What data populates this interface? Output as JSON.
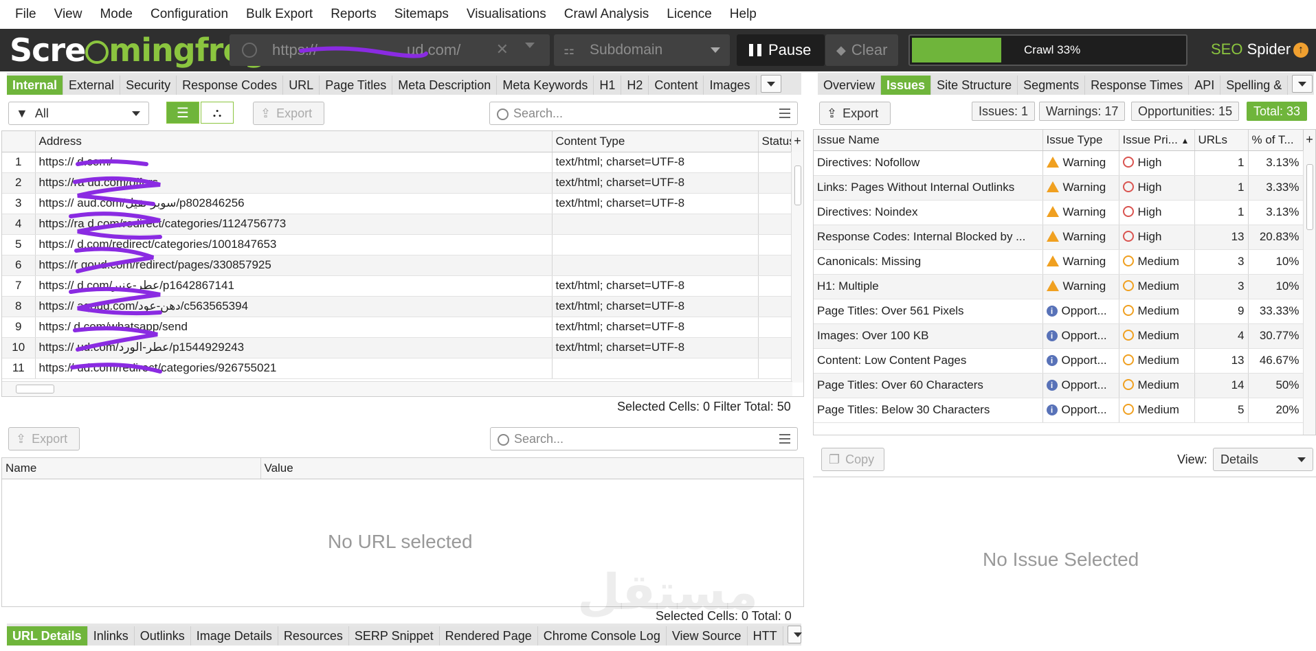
{
  "menu": [
    "File",
    "View",
    "Mode",
    "Configuration",
    "Bulk Export",
    "Reports",
    "Sitemaps",
    "Visualisations",
    "Crawl Analysis",
    "Licence",
    "Help"
  ],
  "topbar": {
    "logo_a": "Scre",
    "logo_b": "mingfrog",
    "url": "https://",
    "url_suffix": "ud.com/",
    "subdomain": "Subdomain",
    "pause": "Pause",
    "clear": "Clear",
    "crawl": "Crawl 33%",
    "crawl_progress": 0.33,
    "seo": "SEO",
    "spider": "Spider",
    "brand_color": "#8bc53f"
  },
  "left_tabs": [
    "Internal",
    "External",
    "Security",
    "Response Codes",
    "URL",
    "Page Titles",
    "Meta Description",
    "Meta Keywords",
    "H1",
    "H2",
    "Content",
    "Images"
  ],
  "filter": {
    "value": "All",
    "export": "Export",
    "search_placeholder": "Search..."
  },
  "main_table": {
    "headers": [
      "Address",
      "Content Type",
      "Status"
    ],
    "rows": [
      {
        "n": "1",
        "address": "https://                    d.com/",
        "type": "text/html; charset=UTF-8"
      },
      {
        "n": "2",
        "address": "https://ra              ud.com/offers",
        "type": "text/html; charset=UTF-8"
      },
      {
        "n": "3",
        "address": "https://                 aud.com/سوبر-نقيل/p802846256",
        "type": "text/html; charset=UTF-8"
      },
      {
        "n": "4",
        "address": "https://ra         d.com/redirect/categories/1124756773",
        "type": ""
      },
      {
        "n": "5",
        "address": "https://              d.com/redirect/categories/1001847653",
        "type": ""
      },
      {
        "n": "6",
        "address": "https://r       qoud.com/redirect/pages/330857925",
        "type": ""
      },
      {
        "n": "7",
        "address": "https://                 d.com/عطر-عنبر/p1642867141",
        "type": "text/html; charset=UTF-8"
      },
      {
        "n": "8",
        "address": "https://          aqoud.com/دهن-عود/c563565394",
        "type": "text/html; charset=UTF-8"
      },
      {
        "n": "9",
        "address": "https:/              d.com/whatsapp/send",
        "type": "text/html; charset=UTF-8"
      },
      {
        "n": "10",
        "address": "https://             ud.com/عطر-الورد/p1544929243",
        "type": "text/html; charset=UTF-8"
      },
      {
        "n": "11",
        "address": "https://             ud.com/redirect/categories/926755021",
        "type": ""
      }
    ],
    "status_bar": "Selected Cells:  0  Filter Total:  50"
  },
  "detail": {
    "export": "Export",
    "search_placeholder": "Search...",
    "headers": [
      "Name",
      "Value"
    ],
    "empty": "No URL selected",
    "status_bar": "Selected Cells:  0  Total:  0"
  },
  "bottom_tabs": [
    "URL Details",
    "Inlinks",
    "Outlinks",
    "Image Details",
    "Resources",
    "SERP Snippet",
    "Rendered Page",
    "Chrome Console Log",
    "View Source",
    "HTT"
  ],
  "right_tabs": [
    "Overview",
    "Issues",
    "Site Structure",
    "Segments",
    "Response Times",
    "API",
    "Spelling &"
  ],
  "issues_toolbar": {
    "export": "Export",
    "issues": "Issues: 1",
    "warnings": "Warnings: 17",
    "opportunities": "Opportunities: 15",
    "total": "Total: 33"
  },
  "issues_table": {
    "headers": [
      "Issue Name",
      "Issue Type",
      "Issue Pri...",
      "URLs",
      "% of T..."
    ],
    "rows": [
      {
        "name": "Directives: Nofollow",
        "type": "Warning",
        "kind": "warn",
        "priority": "High",
        "pk": "high",
        "urls": "1",
        "pct": "3.13%"
      },
      {
        "name": "Links: Pages Without Internal Outlinks",
        "type": "Warning",
        "kind": "warn",
        "priority": "High",
        "pk": "high",
        "urls": "1",
        "pct": "3.33%"
      },
      {
        "name": "Directives: Noindex",
        "type": "Warning",
        "kind": "warn",
        "priority": "High",
        "pk": "high",
        "urls": "1",
        "pct": "3.13%"
      },
      {
        "name": "Response Codes: Internal Blocked by ...",
        "type": "Warning",
        "kind": "warn",
        "priority": "High",
        "pk": "high",
        "urls": "13",
        "pct": "20.83%"
      },
      {
        "name": "Canonicals: Missing",
        "type": "Warning",
        "kind": "warn",
        "priority": "Medium",
        "pk": "med",
        "urls": "3",
        "pct": "10%"
      },
      {
        "name": "H1: Multiple",
        "type": "Warning",
        "kind": "warn",
        "priority": "Medium",
        "pk": "med",
        "urls": "3",
        "pct": "10%"
      },
      {
        "name": "Page Titles: Over 561 Pixels",
        "type": "Opport...",
        "kind": "info",
        "priority": "Medium",
        "pk": "med",
        "urls": "9",
        "pct": "33.33%"
      },
      {
        "name": "Images: Over 100 KB",
        "type": "Opport...",
        "kind": "info",
        "priority": "Medium",
        "pk": "med",
        "urls": "4",
        "pct": "30.77%"
      },
      {
        "name": "Content: Low Content Pages",
        "type": "Opport...",
        "kind": "info",
        "priority": "Medium",
        "pk": "med",
        "urls": "13",
        "pct": "46.67%"
      },
      {
        "name": "Page Titles: Over 60 Characters",
        "type": "Opport...",
        "kind": "info",
        "priority": "Medium",
        "pk": "med",
        "urls": "14",
        "pct": "50%"
      },
      {
        "name": "Page Titles: Below 30 Characters",
        "type": "Opport...",
        "kind": "info",
        "priority": "Medium",
        "pk": "med",
        "urls": "5",
        "pct": "20%"
      }
    ]
  },
  "issue_detail": {
    "copy": "Copy",
    "view_label": "View:",
    "view_value": "Details",
    "empty": "No Issue Selected"
  },
  "watermark": "مستقل"
}
